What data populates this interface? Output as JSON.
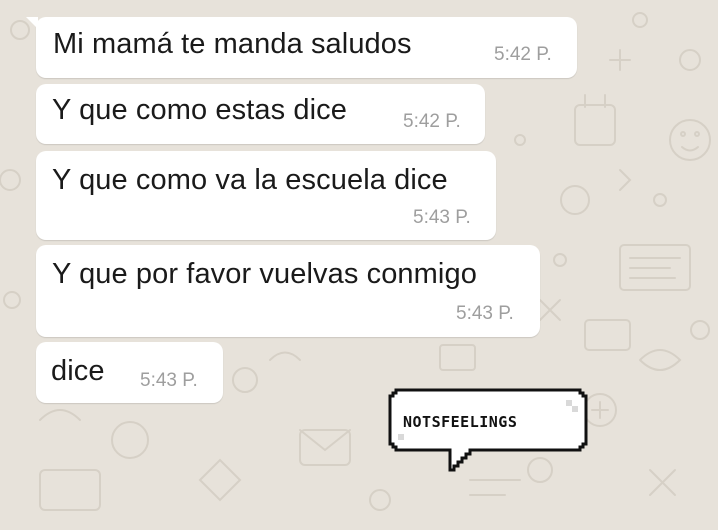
{
  "chat": {
    "messages": [
      {
        "text": "Mi mamá te manda saludos",
        "time": "5:42 P."
      },
      {
        "text": "Y que como estas dice",
        "time": "5:42 P."
      },
      {
        "text": "Y que como va la escuela dice",
        "time": "5:43 P."
      },
      {
        "text": "Y que por favor vuelvas conmigo",
        "time": "5:43 P."
      },
      {
        "text": "dice",
        "time": "5:43 P."
      }
    ]
  },
  "watermark": {
    "text": "NOTSFEELINGS"
  },
  "colors": {
    "background": "#e7e2da",
    "bubble": "#ffffff",
    "text": "#1a1a1a",
    "timestamp": "#9e9e9e"
  }
}
